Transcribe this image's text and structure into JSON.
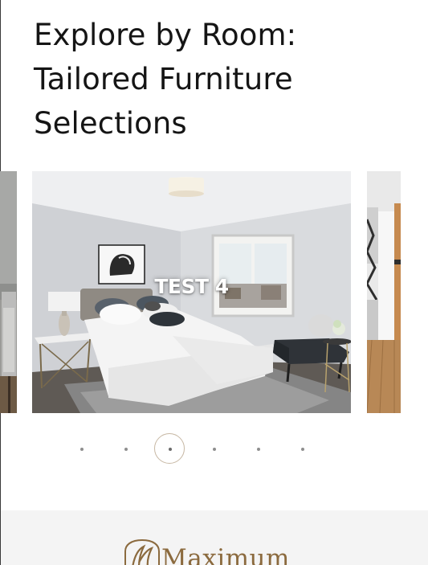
{
  "section": {
    "heading": "Explore by Room:\nTailored Furniture\nSelections"
  },
  "carousel": {
    "slides": [
      {
        "caption": ""
      },
      {
        "caption": "TEST 4"
      },
      {
        "caption": ""
      }
    ],
    "pagination": {
      "count": 6,
      "active_index": 2
    }
  },
  "footer": {
    "brand_name": "Maximum"
  },
  "colors": {
    "heading_text": "#151515",
    "active_dot_ring": "#c7b8a4",
    "dot": "#8e8e8e",
    "footer_bg": "#f4f4f4",
    "brand_gold": "#8b6a3e"
  }
}
